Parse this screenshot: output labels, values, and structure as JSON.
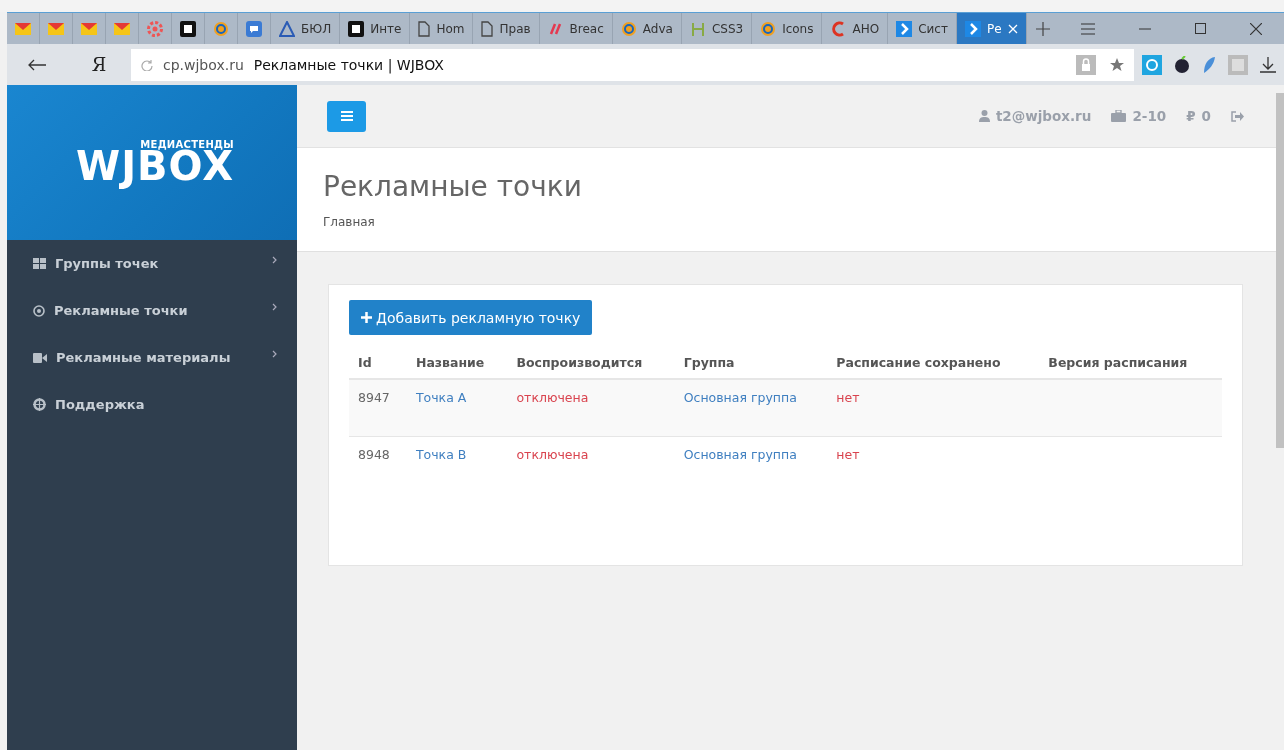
{
  "browser": {
    "tabs": [
      {
        "kind": "mail",
        "selected": false
      },
      {
        "kind": "mail",
        "selected": false
      },
      {
        "kind": "mail",
        "selected": false
      },
      {
        "kind": "mail",
        "selected": false
      },
      {
        "kind": "gear",
        "selected": false
      },
      {
        "kind": "square",
        "selected": false
      },
      {
        "kind": "ring",
        "selected": false
      },
      {
        "kind": "chat",
        "selected": false
      },
      {
        "kind": "triangle",
        "title": "БЮЛ",
        "selected": false
      },
      {
        "kind": "square",
        "title": "Инте",
        "selected": false
      },
      {
        "kind": "doc",
        "title": "Hom",
        "selected": false
      },
      {
        "kind": "doc",
        "title": "Прав",
        "selected": false
      },
      {
        "kind": "slash",
        "title": "Breac",
        "selected": false
      },
      {
        "kind": "ring",
        "title": "Adva",
        "selected": false
      },
      {
        "kind": "bars",
        "title": "CSS3",
        "selected": false
      },
      {
        "kind": "ring",
        "title": "Icons",
        "selected": false
      },
      {
        "kind": "arc",
        "title": "АНО",
        "selected": false
      },
      {
        "kind": "chevron",
        "title": "Сист",
        "selected": false
      },
      {
        "kind": "chevron",
        "title": "Ре",
        "selected": true
      }
    ],
    "yandex": "Я",
    "domain": "cp.wjbox.ru",
    "page_title": "Рекламные точки | WJBOX"
  },
  "sidebar": {
    "brand_tagline": "МЕДИАСТЕНДЫ",
    "brand": "WJBOX",
    "items": [
      {
        "kind": "grid",
        "label": "Группы точек",
        "has_submenu": true
      },
      {
        "kind": "target",
        "label": "Рекламные точки",
        "has_submenu": true
      },
      {
        "kind": "camera",
        "label": "Рекламные материалы",
        "has_submenu": true
      },
      {
        "kind": "lifebuoy",
        "label": "Поддержка",
        "has_submenu": false
      }
    ]
  },
  "topbar": {
    "user": "t2@wjbox.ru",
    "plan": "2-10",
    "currency": "₽",
    "balance": "0"
  },
  "page": {
    "title": "Рекламные точки",
    "breadcrumb": "Главная",
    "add_button": "Добавить рекламную точку"
  },
  "table": {
    "columns": [
      "Id",
      "Название",
      "Воспроизводится",
      "Группа",
      "Расписание сохранено",
      "Версия расписания"
    ],
    "rows": [
      {
        "id": "8947",
        "name": "Точка А",
        "playing": "отключена",
        "group": "Основная группа",
        "schedule_saved": "нет"
      },
      {
        "id": "8948",
        "name": "Точка В",
        "playing": "отключена",
        "group": "Основная группа",
        "schedule_saved": "нет"
      }
    ]
  }
}
